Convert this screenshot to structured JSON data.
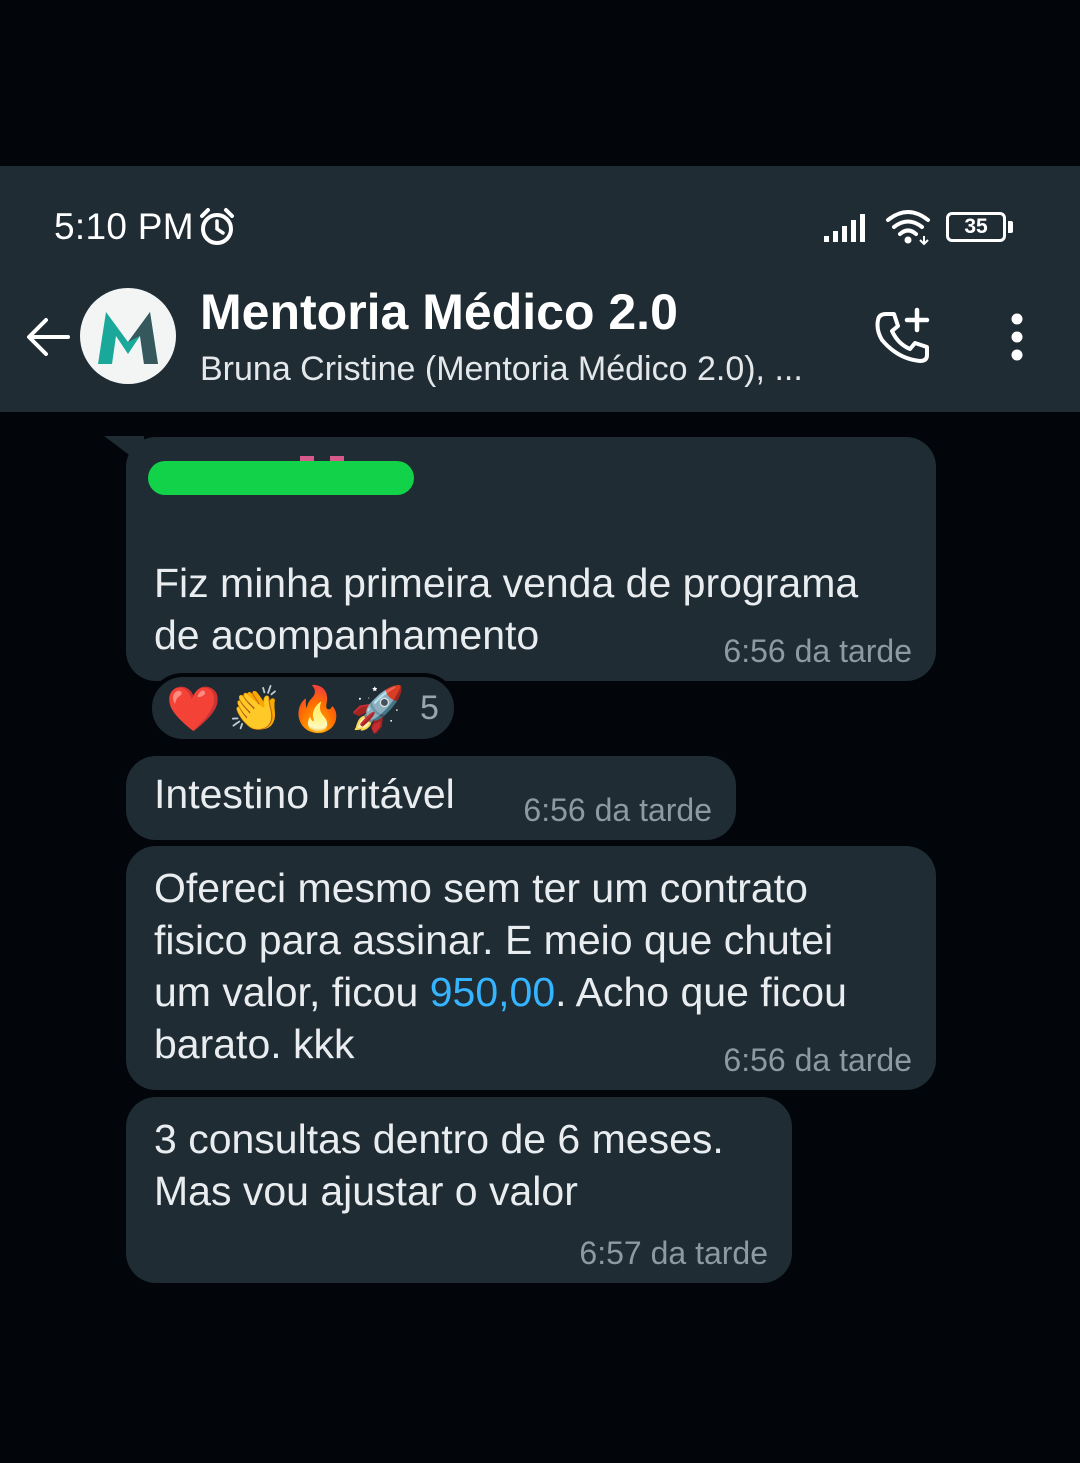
{
  "status_bar": {
    "time": "5:10 PM",
    "battery": "35",
    "icons": [
      "alarm-icon",
      "signal-icon",
      "wifi-icon",
      "battery-icon"
    ]
  },
  "header": {
    "title": "Mentoria Médico 2.0",
    "subtitle": "Bruna Cristine (Mentoria Médico 2.0), ...",
    "icons": [
      "back-arrow-icon",
      "group-avatar",
      "add-call-icon",
      "more-options-icon"
    ]
  },
  "messages": [
    {
      "lines": [
        "Fiz minha primeira venda de programa",
        "de acompanhamento"
      ],
      "time": "6:56 da tarde",
      "reactions": {
        "emojis": [
          "❤️",
          "👏",
          "🔥",
          "🚀"
        ],
        "count": "5"
      }
    },
    {
      "lines": [
        "Intestino Irritável"
      ],
      "time": "6:56 da tarde"
    },
    {
      "lines": [
        "Ofereci mesmo sem ter um contrato",
        "fisico para assinar. E meio que chutei"
      ],
      "line3_before": "um valor, ficou ",
      "line3_link": "950,00",
      "line3_after": ". Acho que ficou",
      "line4": "barato. kkk",
      "time": "6:56 da tarde"
    },
    {
      "lines": [
        "3 consultas dentro de 6 meses.",
        "Mas vou ajustar o valor"
      ],
      "time": "6:57 da tarde"
    }
  ],
  "colors": {
    "background": "#02060b",
    "bar": "#1f2c34",
    "bubble": "#1f2c34",
    "link": "#35b4ff",
    "redaction": "#12d249",
    "avatar_logo": "#1aa89a"
  }
}
